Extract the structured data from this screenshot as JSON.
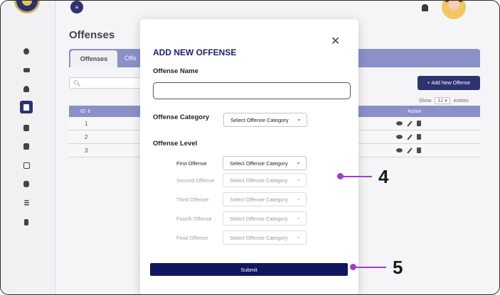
{
  "header": {
    "title": "Offenses"
  },
  "tabs": [
    {
      "label": "Offenses"
    },
    {
      "label": "Offe"
    }
  ],
  "search": {
    "placeholder": ""
  },
  "toolbar": {
    "add_label": "+ Add New Offense",
    "show_label": "Show",
    "show_value": "12",
    "entries_label": "entries"
  },
  "table": {
    "headers": {
      "id": "ID ⇕",
      "action": "Action"
    },
    "rows": [
      {
        "id": "1"
      },
      {
        "id": "2"
      },
      {
        "id": "3"
      }
    ]
  },
  "modal": {
    "title": "ADD NEW OFFENSE",
    "close": "✕",
    "offense_name_label": "Offense Name",
    "offense_name_value": "",
    "category_label": "Offense Category",
    "category_select": "Select Offense Category",
    "level_label": "Offense Level",
    "levels": [
      {
        "label": "First Offense",
        "select": "Select Offense Category",
        "enabled": true
      },
      {
        "label": "Second Offense",
        "select": "Select Offense Category",
        "enabled": false
      },
      {
        "label": "Third Offense",
        "select": "Select Offense Category",
        "enabled": false
      },
      {
        "label": "Fourth Offense",
        "select": "Select Offense Category",
        "enabled": false
      },
      {
        "label": "Final Offense",
        "select": "Select Offense Category",
        "enabled": false
      }
    ],
    "submit_label": "Submit"
  },
  "callouts": [
    {
      "number": "4"
    },
    {
      "number": "5"
    }
  ],
  "colors": {
    "accent": "#11175e",
    "tab_bar": "#7a82c0",
    "callout": "#a33bd1"
  }
}
